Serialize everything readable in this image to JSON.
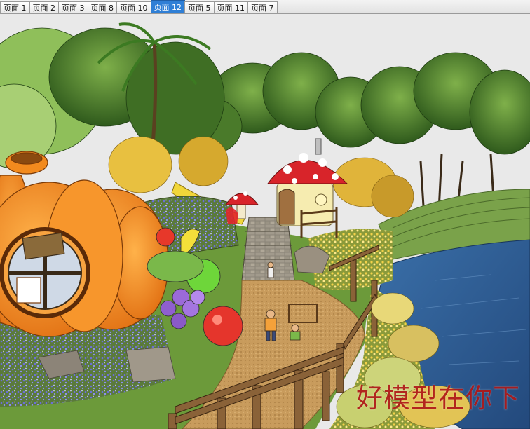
{
  "tabs": [
    {
      "label": "页面 1",
      "active": false
    },
    {
      "label": "页面 2",
      "active": false
    },
    {
      "label": "页面 3",
      "active": false
    },
    {
      "label": "页面 8",
      "active": false
    },
    {
      "label": "页面 10",
      "active": false
    },
    {
      "label": "页面 12",
      "active": true
    },
    {
      "label": "页面 5",
      "active": false
    },
    {
      "label": "页面 11",
      "active": false
    },
    {
      "label": "页面 7",
      "active": false
    }
  ],
  "watermark": "好模型在你下",
  "colors": {
    "active_tab": "#2f7fd6",
    "water": "#2f5f9a",
    "pumpkin": "#f28a1e",
    "grass": "#6c9a3a",
    "path": "#c79a5a",
    "watermark": "#b01818"
  },
  "scene": {
    "objects": [
      "pumpkin-house",
      "mushroom-house",
      "small-mushroom",
      "yellow-slide",
      "stone-stairs",
      "pond",
      "wooden-fence",
      "fruit-sculptures",
      "children-figures",
      "flower-beds",
      "trees",
      "palm-tree"
    ]
  }
}
